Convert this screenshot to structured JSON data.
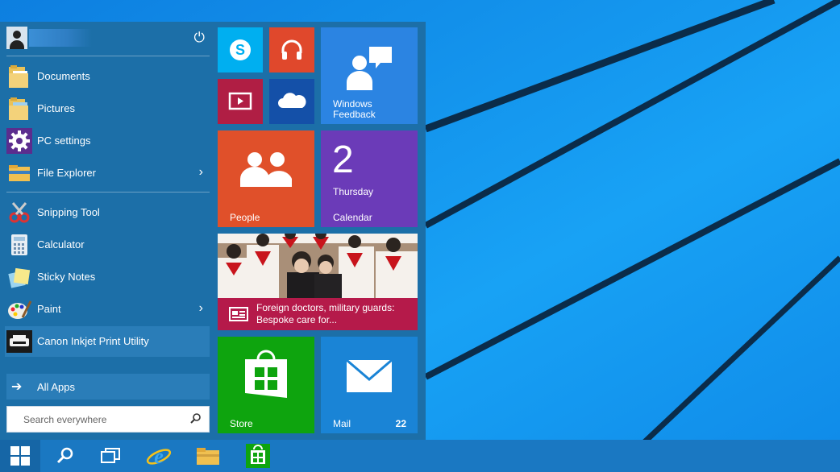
{
  "start_menu": {
    "power_icon": "power-icon",
    "places": [
      {
        "label": "Documents",
        "icon": "documents-folder-icon"
      },
      {
        "label": "Pictures",
        "icon": "pictures-folder-icon"
      },
      {
        "label": "PC settings",
        "icon": "settings-gear-icon"
      },
      {
        "label": "File Explorer",
        "icon": "file-explorer-icon",
        "has_submenu": true
      }
    ],
    "apps": [
      {
        "label": "Snipping Tool",
        "icon": "snipping-tool-icon"
      },
      {
        "label": "Calculator",
        "icon": "calculator-icon"
      },
      {
        "label": "Sticky Notes",
        "icon": "sticky-notes-icon"
      },
      {
        "label": "Paint",
        "icon": "paint-icon",
        "has_submenu": true
      },
      {
        "label": "Canon Inkjet Print Utility",
        "icon": "printer-icon",
        "highlighted": true
      }
    ],
    "all_apps_label": "All Apps",
    "search": {
      "placeholder": "Search everywhere",
      "value": ""
    },
    "submenu_arrow": "›"
  },
  "tiles": {
    "skype": {
      "icon": "skype-icon",
      "color": "#00aff0"
    },
    "music": {
      "icon": "headphones-icon",
      "color": "#e0482c"
    },
    "video": {
      "icon": "video-icon",
      "color": "#b01e44"
    },
    "onedrive": {
      "icon": "onedrive-cloud-icon",
      "color": "#1450a8"
    },
    "windows_feedback": {
      "label_line1": "Windows",
      "label_line2": "Feedback",
      "color": "#2b84e2"
    },
    "people": {
      "label": "People",
      "color": "#e0502a"
    },
    "calendar": {
      "day_number": "2",
      "weekday": "Thursday",
      "label": "Calendar",
      "color": "#6b3bb8"
    },
    "news": {
      "headline": "Foreign doctors, military guards: Bespoke care for...",
      "color": "#b51a4a"
    },
    "store": {
      "label": "Store",
      "color": "#0ea40e"
    },
    "mail": {
      "label": "Mail",
      "badge": "22",
      "color": "#1a84d6"
    }
  },
  "taskbar": {
    "items": [
      "windows-start-icon",
      "search-icon",
      "task-view-icon",
      "internet-explorer-icon",
      "file-explorer-icon",
      "store-icon"
    ]
  },
  "colors": {
    "start_menu_bg": "#1c6fa8",
    "desktop_bg": "#1296f0",
    "taskbar_bg": "#1a78c2"
  }
}
